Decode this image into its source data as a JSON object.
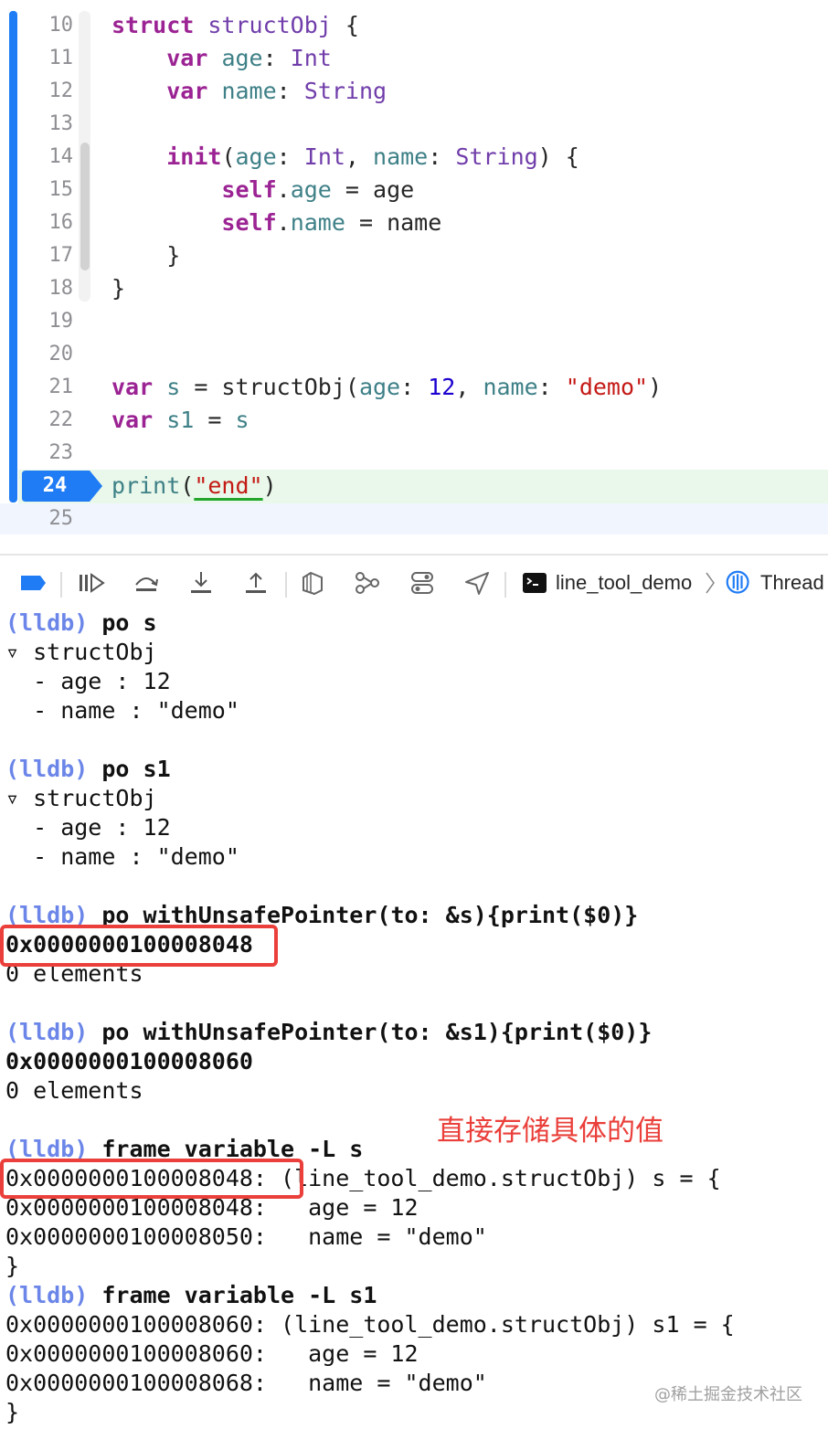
{
  "editor": {
    "lines": [
      {
        "num": "10",
        "parts": [
          {
            "t": "struct",
            "c": "kw"
          },
          {
            "t": " "
          },
          {
            "t": "structObj",
            "c": "ty"
          },
          {
            "t": " {"
          }
        ]
      },
      {
        "num": "11",
        "parts": [
          {
            "t": "    "
          },
          {
            "t": "var",
            "c": "kw"
          },
          {
            "t": " "
          },
          {
            "t": "age",
            "c": "pr"
          },
          {
            "t": ": "
          },
          {
            "t": "Int",
            "c": "ty"
          }
        ]
      },
      {
        "num": "12",
        "parts": [
          {
            "t": "    "
          },
          {
            "t": "var",
            "c": "kw"
          },
          {
            "t": " "
          },
          {
            "t": "name",
            "c": "pr"
          },
          {
            "t": ": "
          },
          {
            "t": "String",
            "c": "ty"
          }
        ]
      },
      {
        "num": "13",
        "parts": []
      },
      {
        "num": "14",
        "parts": [
          {
            "t": "    "
          },
          {
            "t": "init",
            "c": "kw"
          },
          {
            "t": "("
          },
          {
            "t": "age",
            "c": "pr"
          },
          {
            "t": ": "
          },
          {
            "t": "Int",
            "c": "ty"
          },
          {
            "t": ", "
          },
          {
            "t": "name",
            "c": "pr"
          },
          {
            "t": ": "
          },
          {
            "t": "String",
            "c": "ty"
          },
          {
            "t": ") {"
          }
        ]
      },
      {
        "num": "15",
        "parts": [
          {
            "t": "        "
          },
          {
            "t": "self",
            "c": "kw"
          },
          {
            "t": "."
          },
          {
            "t": "age",
            "c": "pr"
          },
          {
            "t": " = age"
          }
        ]
      },
      {
        "num": "16",
        "parts": [
          {
            "t": "        "
          },
          {
            "t": "self",
            "c": "kw"
          },
          {
            "t": "."
          },
          {
            "t": "name",
            "c": "pr"
          },
          {
            "t": " = name"
          }
        ]
      },
      {
        "num": "17",
        "parts": [
          {
            "t": "    }"
          }
        ]
      },
      {
        "num": "18",
        "parts": [
          {
            "t": "}"
          }
        ]
      },
      {
        "num": "19",
        "parts": []
      },
      {
        "num": "20",
        "parts": []
      },
      {
        "num": "21",
        "parts": [
          {
            "t": "var",
            "c": "kw"
          },
          {
            "t": " "
          },
          {
            "t": "s",
            "c": "pr"
          },
          {
            "t": " = structObj("
          },
          {
            "t": "age",
            "c": "pr"
          },
          {
            "t": ": "
          },
          {
            "t": "12",
            "c": "nm"
          },
          {
            "t": ", "
          },
          {
            "t": "name",
            "c": "pr"
          },
          {
            "t": ": "
          },
          {
            "t": "\"demo\"",
            "c": "st"
          },
          {
            "t": ")"
          }
        ]
      },
      {
        "num": "22",
        "parts": [
          {
            "t": "var",
            "c": "kw"
          },
          {
            "t": " "
          },
          {
            "t": "s1",
            "c": "pr"
          },
          {
            "t": " = "
          },
          {
            "t": "s",
            "c": "pr"
          }
        ]
      },
      {
        "num": "23",
        "parts": []
      },
      {
        "num": "24",
        "parts": [
          {
            "t": "print",
            "c": "pr"
          },
          {
            "t": "("
          },
          {
            "t": "\"end\"",
            "c": "st squig"
          },
          {
            "t": ")"
          }
        ]
      },
      {
        "num": "25",
        "parts": []
      }
    ],
    "current_line": "24"
  },
  "toolbar": {
    "target": "line_tool_demo",
    "thread": "Thread"
  },
  "console": {
    "lines": [
      {
        "parts": [
          {
            "t": "(lldb)",
            "c": "lldb"
          },
          {
            "t": " po s",
            "c": "cmd"
          }
        ]
      },
      {
        "parts": [
          {
            "t": "▿ structObj"
          }
        ]
      },
      {
        "parts": [
          {
            "t": "  - age : 12"
          }
        ]
      },
      {
        "parts": [
          {
            "t": "  - name : \"demo\""
          }
        ]
      },
      {
        "parts": [
          {
            "t": ""
          }
        ]
      },
      {
        "parts": [
          {
            "t": "(lldb)",
            "c": "lldb"
          },
          {
            "t": " po s1",
            "c": "cmd"
          }
        ]
      },
      {
        "parts": [
          {
            "t": "▿ structObj"
          }
        ]
      },
      {
        "parts": [
          {
            "t": "  - age : 12"
          }
        ]
      },
      {
        "parts": [
          {
            "t": "  - name : \"demo\""
          }
        ]
      },
      {
        "parts": [
          {
            "t": ""
          }
        ]
      },
      {
        "parts": [
          {
            "t": "(lldb)",
            "c": "lldb"
          },
          {
            "t": " po withUnsafePointer(to: &s){print($0)}",
            "c": "cmd"
          }
        ]
      },
      {
        "parts": [
          {
            "t": "0x0000000100008048",
            "c": "bold"
          }
        ]
      },
      {
        "parts": [
          {
            "t": "0 elements"
          }
        ]
      },
      {
        "parts": [
          {
            "t": ""
          }
        ]
      },
      {
        "parts": [
          {
            "t": "(lldb)",
            "c": "lldb"
          },
          {
            "t": " po withUnsafePointer(to: &s1){print($0)}",
            "c": "cmd"
          }
        ]
      },
      {
        "parts": [
          {
            "t": "0x0000000100008060",
            "c": "bold"
          }
        ]
      },
      {
        "parts": [
          {
            "t": "0 elements"
          }
        ]
      },
      {
        "parts": [
          {
            "t": ""
          }
        ]
      },
      {
        "parts": [
          {
            "t": "(lldb)",
            "c": "lldb"
          },
          {
            "t": " frame variable -L s",
            "c": "cmd"
          }
        ]
      },
      {
        "parts": [
          {
            "t": "0x0000000100008048: (line_tool_demo.structObj) s = {"
          }
        ]
      },
      {
        "parts": [
          {
            "t": "0x0000000100008048:   age = 12"
          }
        ]
      },
      {
        "parts": [
          {
            "t": "0x0000000100008050:   name = \"demo\""
          }
        ]
      },
      {
        "parts": [
          {
            "t": "}"
          }
        ]
      },
      {
        "parts": [
          {
            "t": "(lldb)",
            "c": "lldb"
          },
          {
            "t": " frame variable -L s1",
            "c": "cmd"
          }
        ]
      },
      {
        "parts": [
          {
            "t": "0x0000000100008060: (line_tool_demo.structObj) s1 = {"
          }
        ]
      },
      {
        "parts": [
          {
            "t": "0x0000000100008060:   age = 12"
          }
        ]
      },
      {
        "parts": [
          {
            "t": "0x0000000100008068:   name = \"demo\""
          }
        ]
      },
      {
        "parts": [
          {
            "t": "}"
          }
        ]
      }
    ]
  },
  "annotation": "直接存储具体的值",
  "watermark": "@稀土掘金技术社区",
  "colors": {
    "accent": "#1f7cf5",
    "highlight_box": "#ea3f3a",
    "lldb_prompt": "#6b86e8",
    "current_line_bg": "#e9f8ea"
  }
}
